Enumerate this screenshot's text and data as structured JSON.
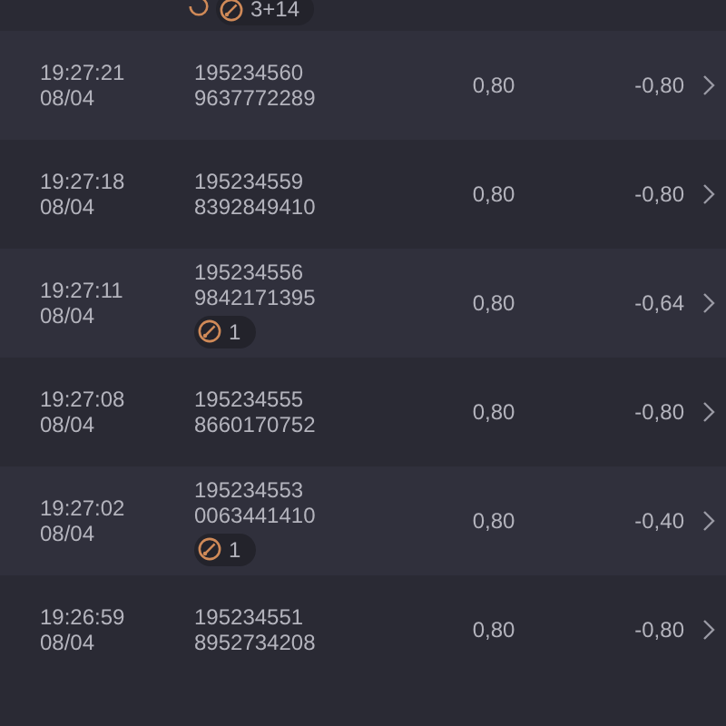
{
  "top_row": {
    "badge": "3+14"
  },
  "rows": [
    {
      "time": "19:27:21",
      "date": "08/04",
      "id_1": "195234560",
      "id_2": "9637772289",
      "value": "0,80",
      "change": "-0,80"
    },
    {
      "time": "19:27:18",
      "date": "08/04",
      "id_1": "195234559",
      "id_2": "8392849410",
      "value": "0,80",
      "change": "-0,80"
    },
    {
      "time": "19:27:11",
      "date": "08/04",
      "id_1": "195234556",
      "id_2": "9842171395",
      "badge": "1",
      "value": "0,80",
      "change": "-0,64"
    },
    {
      "time": "19:27:08",
      "date": "08/04",
      "id_1": "195234555",
      "id_2": "8660170752",
      "value": "0,80",
      "change": "-0,80"
    },
    {
      "time": "19:27:02",
      "date": "08/04",
      "id_1": "195234553",
      "id_2": "0063441410",
      "badge": "1",
      "value": "0,80",
      "change": "-0,40"
    },
    {
      "time": "19:26:59",
      "date": "08/04",
      "id_1": "195234551",
      "id_2": "8952734208",
      "value": "0,80",
      "change": "-0,80"
    }
  ]
}
